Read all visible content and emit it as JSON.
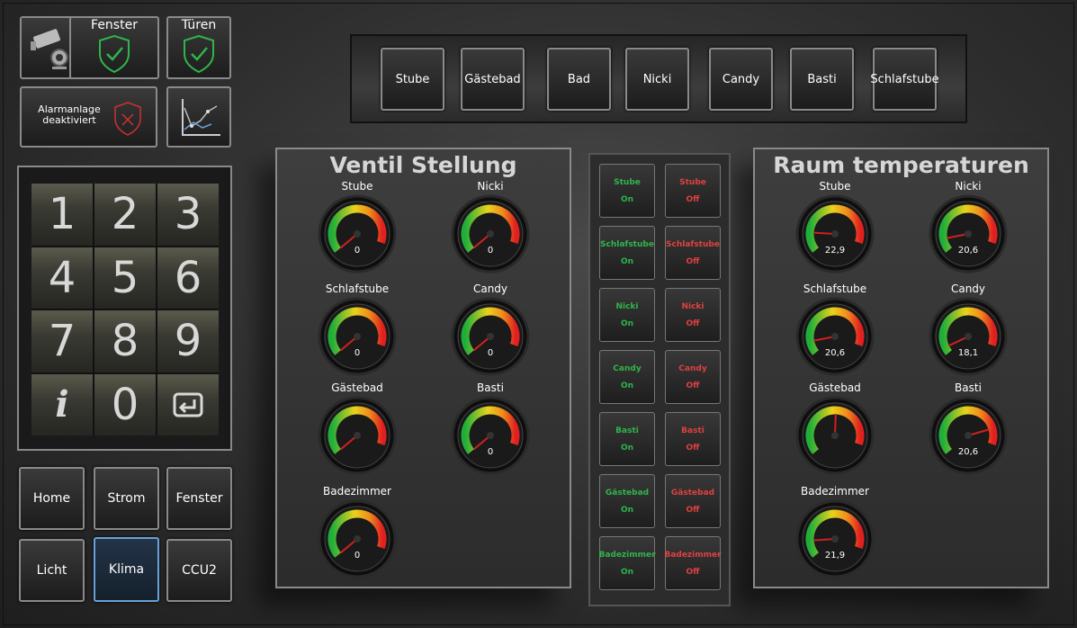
{
  "colors": {
    "on": "#2fb54a",
    "off": "#e04040",
    "accent": "#6aa0d8"
  },
  "top_icons": {
    "camera_icon": "camera-icon",
    "fenster_label": "Fenster",
    "tueren_label": "Türen",
    "alarm_label": "Alarmanlage deaktiviert",
    "chart_icon": "chart-icon"
  },
  "keypad": {
    "keys": [
      "1",
      "2",
      "3",
      "4",
      "5",
      "6",
      "7",
      "8",
      "9",
      "i",
      "0",
      "enter"
    ]
  },
  "nav": {
    "home": "Home",
    "strom": "Strom",
    "fenster": "Fenster",
    "licht": "Licht",
    "klima": "Klima",
    "ccu2": "CCU2"
  },
  "rooms": [
    "Stube",
    "Gästebad",
    "Bad",
    "Nicki",
    "Candy",
    "Basti",
    "Schlafstube"
  ],
  "ventil": {
    "title": "Ventil Stellung",
    "gauges": [
      {
        "name": "Stube",
        "value": "0",
        "level": 0
      },
      {
        "name": "Nicki",
        "value": "0",
        "level": 0
      },
      {
        "name": "Schlafstube",
        "value": "0",
        "level": 0
      },
      {
        "name": "Candy",
        "value": "0",
        "level": 0
      },
      {
        "name": "Gästebad",
        "value": "",
        "level": 0
      },
      {
        "name": "Basti",
        "value": "0",
        "level": 0
      },
      {
        "name": "Badezimmer",
        "value": "0",
        "level": 0
      }
    ]
  },
  "switches": [
    {
      "on": "Stube",
      "off": "Stube",
      "on_state": "On",
      "off_state": "Off"
    },
    {
      "on": "Schlafstube",
      "off": "Schlafstube",
      "on_state": "On",
      "off_state": "Off"
    },
    {
      "on": "Nicki",
      "off": "Nicki",
      "on_state": "On",
      "off_state": "Off"
    },
    {
      "on": "Candy",
      "off": "Candy",
      "on_state": "On",
      "off_state": "Off"
    },
    {
      "on": "Basti",
      "off": "Basti",
      "on_state": "On",
      "off_state": "Off"
    },
    {
      "on": "Gästebad",
      "off": "Gästebad",
      "on_state": "On",
      "off_state": "Off"
    },
    {
      "on": "Badezimmer",
      "off": "Badezimmer",
      "on_state": "On",
      "off_state": "Off"
    }
  ],
  "temps": {
    "title": "Raum temperaturen",
    "gauges": [
      {
        "name": "Stube",
        "value": "22,9",
        "level": 0.18
      },
      {
        "name": "Nicki",
        "value": "20,6",
        "level": 0.12
      },
      {
        "name": "Schlafstube",
        "value": "20,6",
        "level": 0.12
      },
      {
        "name": "Candy",
        "value": "18,1",
        "level": 0.06
      },
      {
        "name": "Gästebad",
        "value": "",
        "level": 0.55
      },
      {
        "name": "Basti",
        "value": "20,6",
        "level": 0.85
      },
      {
        "name": "Badezimmer",
        "value": "21,9",
        "level": 0.15
      }
    ]
  }
}
